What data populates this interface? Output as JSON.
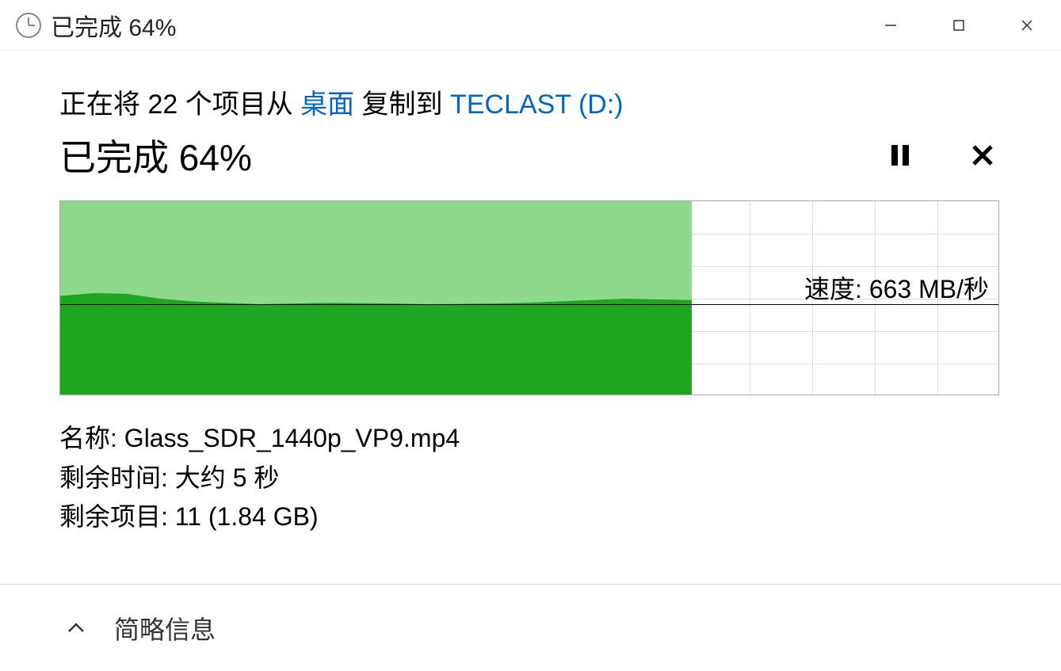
{
  "window": {
    "title": "已完成 64%"
  },
  "copy": {
    "prefix": "正在将 22 个项目从 ",
    "source": "桌面",
    "middle": " 复制到 ",
    "destination": "TECLAST (D:)"
  },
  "progress": {
    "label": "已完成 64%",
    "percent": 64
  },
  "speed": {
    "label": "速度: 663 MB/秒",
    "value_mb_s": 663
  },
  "details": {
    "name_label": "名称: ",
    "name_value": "Glass_SDR_1440p_VP9.mp4",
    "time_label": "剩余时间: ",
    "time_value": "大约 5 秒",
    "items_label": "剩余项目: ",
    "items_value": "11 (1.84 GB)"
  },
  "footer": {
    "toggle_label": "简略信息"
  },
  "chart_data": {
    "type": "area",
    "title": "Copy speed over time",
    "xlabel": "",
    "ylabel": "速度 (MB/秒)",
    "ylim": [
      0,
      1400
    ],
    "progress_fraction": 0.672,
    "current_speed": 663,
    "x": [
      0,
      1,
      2,
      3,
      4,
      5,
      6,
      7,
      8,
      9,
      10,
      11,
      12,
      13,
      14,
      15,
      16,
      17,
      18,
      19
    ],
    "values": [
      720,
      740,
      735,
      700,
      680,
      670,
      660,
      665,
      670,
      668,
      665,
      660,
      662,
      665,
      670,
      680,
      690,
      700,
      695,
      690
    ]
  },
  "colors": {
    "link": "#0066cc",
    "area_light": "#8fd98f",
    "area_dark": "#1fa51f"
  }
}
